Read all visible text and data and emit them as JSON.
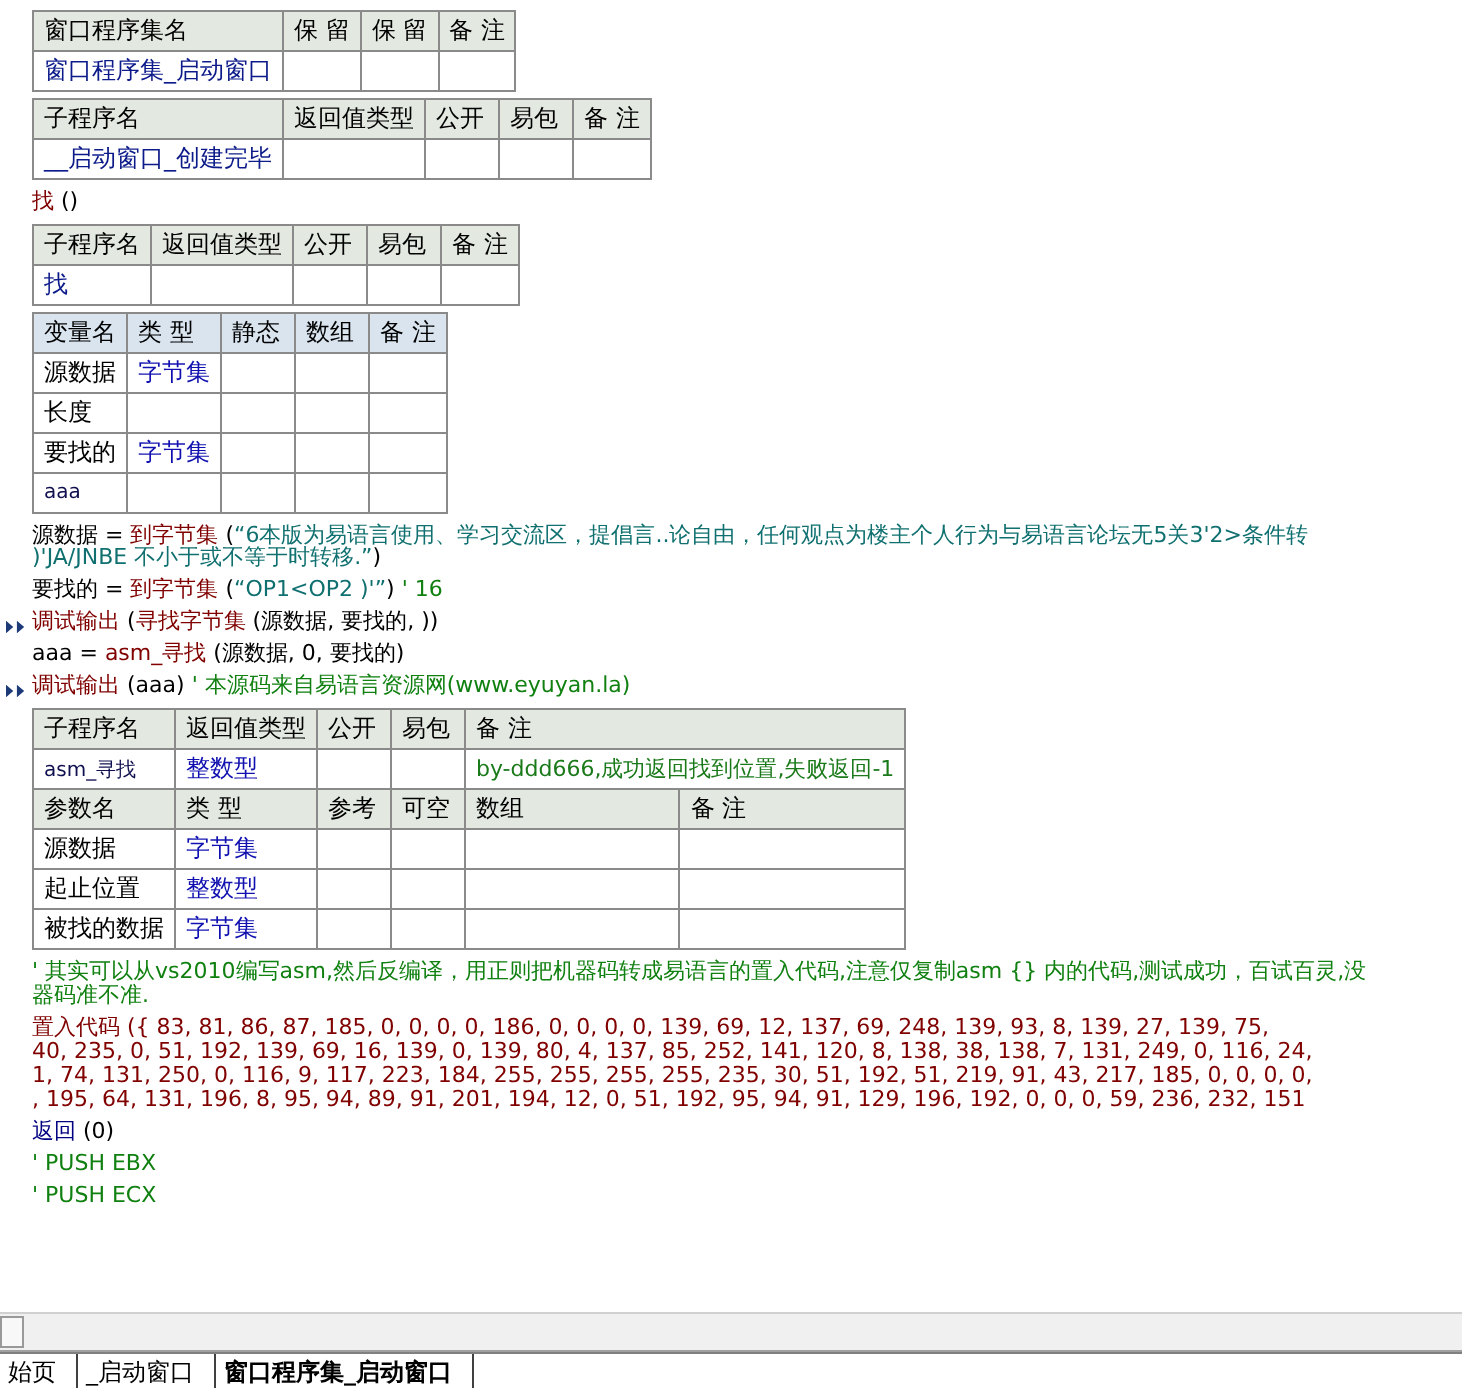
{
  "blocks": [
    {
      "kind": "routine_table",
      "sections": [
        {
          "header": [
            "窗口程序集名",
            "保 留",
            "保 留",
            "备 注"
          ],
          "rows": [
            [
              {
                "kind": "name",
                "text": "窗口程序集_启动窗口"
              },
              null,
              null,
              null
            ]
          ]
        }
      ]
    },
    {
      "kind": "routine_table",
      "sections": [
        {
          "header": [
            "子程序名",
            "返回值类型",
            "公开",
            "易包",
            "备 注"
          ],
          "rows": [
            [
              {
                "kind": "name",
                "text": "__启动窗口_创建完毕"
              },
              null,
              null,
              null,
              null
            ]
          ]
        }
      ]
    },
    {
      "kind": "code",
      "statements": [
        {
          "marker": false,
          "rows": [
            [
              {
                "kind": "command",
                "text": "找"
              },
              {
                "kind": "plain",
                "text": " ()"
              }
            ]
          ]
        }
      ]
    },
    {
      "kind": "routine_table",
      "sections": [
        {
          "header": [
            "子程序名",
            "返回值类型",
            "公开",
            "易包",
            "备 注"
          ],
          "rows": [
            [
              {
                "kind": "name",
                "text": "找"
              },
              null,
              null,
              null,
              null
            ]
          ]
        }
      ]
    },
    {
      "kind": "variable_table",
      "sections": [
        {
          "header": [
            "变量名",
            "类 型",
            "静态",
            "数组",
            "备 注"
          ],
          "rows": [
            [
              {
                "kind": "plain",
                "text": "源数据"
              },
              {
                "kind": "type",
                "text": "字节集"
              },
              null,
              null,
              null
            ],
            [
              {
                "kind": "plain",
                "text": "长度"
              },
              null,
              null,
              null,
              null
            ],
            [
              {
                "kind": "plain",
                "text": "要找的"
              },
              {
                "kind": "type",
                "text": "字节集"
              },
              null,
              null,
              null
            ],
            [
              {
                "kind": "small",
                "text": "aaa"
              },
              null,
              null,
              null,
              null
            ]
          ]
        }
      ]
    },
    {
      "kind": "code",
      "statements": [
        {
          "kind": "line",
          "marker": false,
          "rows": [
            [
              {
                "kind": "plain",
                "text": "源数据 = "
              },
              {
                "kind": "command",
                "text": "到字节集"
              },
              {
                "kind": "plain",
                "text": " ("
              },
              {
                "kind": "string",
                "text": "“6本版为易语言使用、学习交流区，提倡言..论自由，任何观点为楼主个人行为与易语言论坛无5关3'2>条件转"
              }
            ]
          ]
        },
        {
          "kind": "continuation",
          "marker": false,
          "rows": [
            [
              {
                "kind": "string",
                "text": ")'JA/JNBE 不小于或不等于时转移.”"
              },
              {
                "kind": "plain",
                "text": ")"
              }
            ]
          ]
        },
        {
          "marker": false,
          "rows": [
            [
              {
                "kind": "plain",
                "text": "要找的 = "
              },
              {
                "kind": "command",
                "text": "到字节集"
              },
              {
                "kind": "plain",
                "text": " ("
              },
              {
                "kind": "string",
                "text": "“OP1<OP2 )'”"
              },
              {
                "kind": "plain",
                "text": ") "
              },
              {
                "kind": "comment",
                "text": "' 16"
              }
            ]
          ]
        },
        {
          "marker": true,
          "rows": [
            [
              {
                "kind": "command",
                "text": "调试输出"
              },
              {
                "kind": "plain",
                "text": " ("
              },
              {
                "kind": "command",
                "text": "寻找字节集"
              },
              {
                "kind": "plain",
                "text": " (源数据, 要找的, ))"
              }
            ]
          ]
        },
        {
          "marker": false,
          "rows": [
            [
              {
                "kind": "plain",
                "text": "aaa = "
              },
              {
                "kind": "command",
                "text": "asm_寻找"
              },
              {
                "kind": "plain",
                "text": " (源数据, 0, 要找的)"
              }
            ]
          ]
        },
        {
          "marker": true,
          "rows": [
            [
              {
                "kind": "command",
                "text": "调试输出"
              },
              {
                "kind": "plain",
                "text": " (aaa) "
              },
              {
                "kind": "comment",
                "text": "' 本源码来自易语言资源网(www.eyuyan.la)"
              }
            ]
          ]
        }
      ]
    },
    {
      "kind": "routine_table",
      "sections": [
        {
          "header": [
            "子程序名",
            "返回值类型",
            "公开",
            "易包",
            "备 注"
          ],
          "rows": [
            [
              {
                "kind": "small",
                "text": "asm_寻找"
              },
              {
                "kind": "type",
                "text": "整数型"
              },
              null,
              null,
              {
                "kind": "remark",
                "text": "by-ddd666,成功返回找到位置,失败返回-1"
              }
            ]
          ]
        },
        {
          "header": [
            "参数名",
            "类 型",
            "参考",
            "可空",
            "数组",
            "备 注"
          ],
          "rows": [
            [
              {
                "kind": "plain",
                "text": "源数据"
              },
              {
                "kind": "type",
                "text": "字节集"
              },
              null,
              null,
              null,
              null
            ],
            [
              {
                "kind": "plain",
                "text": "起止位置"
              },
              {
                "kind": "type",
                "text": "整数型"
              },
              null,
              null,
              null,
              null
            ],
            [
              {
                "kind": "plain",
                "text": "被找的数据"
              },
              {
                "kind": "type",
                "text": "字节集"
              },
              null,
              null,
              null,
              null
            ]
          ]
        }
      ]
    },
    {
      "kind": "code",
      "statements": [
        {
          "marker": false,
          "rows": [
            [
              {
                "kind": "comment",
                "text": "' 其实可以从vs2010编写asm,然后反编译，用正则把机器码转成易语言的置入代码,注意仅复制asm {} 内的代码,测试成功，百试百灵,没"
              }
            ],
            [
              {
                "kind": "comment",
                "text": "器码准不准."
              }
            ]
          ]
        },
        {
          "marker": false,
          "rows": [
            [
              {
                "kind": "command",
                "text": "置入代码"
              },
              {
                "kind": "command",
                "text": " ({ 83, 81, 86, 87, 185, 0, 0, 0, 0, 186, 0, 0, 0, 0, 139, 69, 12, 137, 69, 248, 139, 93, 8, 139, 27, 139, 75,"
              }
            ],
            [
              {
                "kind": "command",
                "text": "40, 235, 0, 51, 192, 139, 69, 16, 139, 0, 139, 80, 4, 137, 85, 252, 141, 120, 8, 138, 38, 138, 7, 131, 249, 0, 116, 24,"
              }
            ],
            [
              {
                "kind": "command",
                "text": "1, 74, 131, 250, 0, 116, 9, 117, 223, 184, 255, 255, 255, 255, 235, 30, 51, 192, 51, 219, 91, 43, 217, 185, 0, 0, 0, 0,"
              }
            ],
            [
              {
                "kind": "command",
                "text": ", 195, 64, 131, 196, 8, 95, 94, 89, 91, 201, 194, 12, 0, 51, 192, 95, 94, 91, 129, 196, 192, 0, 0, 0, 59, 236, 232, 151"
              }
            ]
          ]
        },
        {
          "marker": false,
          "rows": [
            [
              {
                "kind": "flow",
                "text": "返回"
              },
              {
                "kind": "plain",
                "text": " (0)"
              }
            ]
          ]
        },
        {
          "marker": false,
          "rows": [
            [
              {
                "kind": "comment",
                "text": "' PUSH EBX"
              }
            ]
          ]
        },
        {
          "marker": false,
          "rows": [
            [
              {
                "kind": "comment",
                "text": "' PUSH ECX"
              }
            ]
          ]
        }
      ]
    }
  ],
  "tabs": [
    {
      "label": "始页",
      "selected": false
    },
    {
      "label": "_启动窗口",
      "selected": false
    },
    {
      "label": "窗口程序集_启动窗口",
      "selected": true
    }
  ]
}
